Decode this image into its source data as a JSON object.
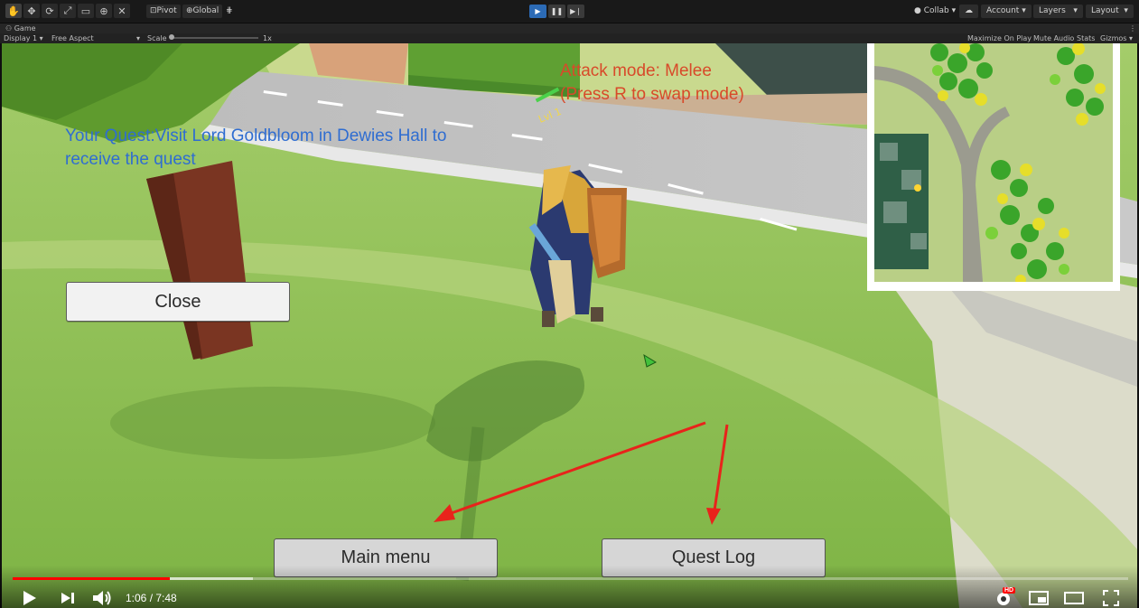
{
  "editor": {
    "tools": [
      "hand-icon",
      "move-icon",
      "rotate-icon",
      "scale-icon",
      "rect-icon",
      "transform-icon",
      "custom-tool-icon"
    ],
    "pivot_label": "Pivot",
    "global_label": "Global",
    "collab_label": "Collab",
    "account_label": "Account",
    "layers_label": "Layers",
    "layout_label": "Layout",
    "game_tab_label": "Game",
    "display_label": "Display 1",
    "aspect_label": "Free Aspect",
    "scale_label": "Scale",
    "scale_value": "1x",
    "maximize_label": "Maximize On Play",
    "mute_label": "Mute Audio",
    "stats_label": "Stats",
    "gizmos_label": "Gizmos",
    "play_active": true
  },
  "game": {
    "quest_text": "Your Quest:Visit Lord Goldbloom in Dewies Hall to receive the quest",
    "attack_line1": "Attack mode: Melee",
    "attack_line2": "(Press R to swap mode)",
    "close_button": "Close",
    "main_menu_button": "Main menu",
    "quest_log_button": "Quest Log",
    "quest_color": "#2f6dd1",
    "attack_color": "#d84a2a",
    "annotation_arrow_color": "#e8231b"
  },
  "player": {
    "current_time": "1:06",
    "duration": "7:48",
    "time_display": "1:06 / 7:48",
    "progress_fraction": 0.141,
    "hd_badge": "HD",
    "progress_color": "#ff0000"
  }
}
